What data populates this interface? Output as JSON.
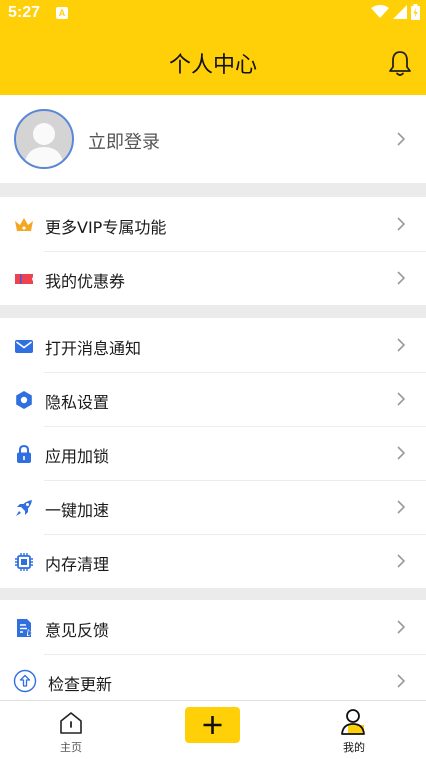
{
  "status_bar": {
    "time": "5:27",
    "notif_label": "A"
  },
  "header": {
    "title": "个人中心",
    "bell_icon": "bell-icon"
  },
  "login": {
    "label": "立即登录",
    "avatar_icon": "default-avatar-icon"
  },
  "groups": [
    {
      "items": [
        {
          "label": "更多VIP专属功能",
          "icon": "crown-icon",
          "color": "#f5a623"
        },
        {
          "label": "我的优惠券",
          "icon": "coupon-icon",
          "color": "#f0414f"
        }
      ]
    },
    {
      "items": [
        {
          "label": "打开消息通知",
          "icon": "mail-icon",
          "color": "#2f6fe0"
        },
        {
          "label": "隐私设置",
          "icon": "gear-icon",
          "color": "#2f6fe0"
        },
        {
          "label": "应用加锁",
          "icon": "lock-icon",
          "color": "#2f6fe0"
        },
        {
          "label": "一键加速",
          "icon": "rocket-icon",
          "color": "#2f6fe0"
        },
        {
          "label": "内存清理",
          "icon": "chip-icon",
          "color": "#2f6fe0"
        }
      ]
    },
    {
      "items": [
        {
          "label": "意见反馈",
          "icon": "feedback-icon",
          "color": "#2f6fe0"
        },
        {
          "label": "检查更新",
          "icon": "update-icon",
          "color": "#2f6fe0"
        }
      ]
    }
  ],
  "tabbar": {
    "home_label": "主页",
    "add_icon": "plus-icon",
    "mine_label": "我的"
  },
  "colors": {
    "accent": "#ffcf08",
    "icon_blue": "#2f6fe0"
  }
}
